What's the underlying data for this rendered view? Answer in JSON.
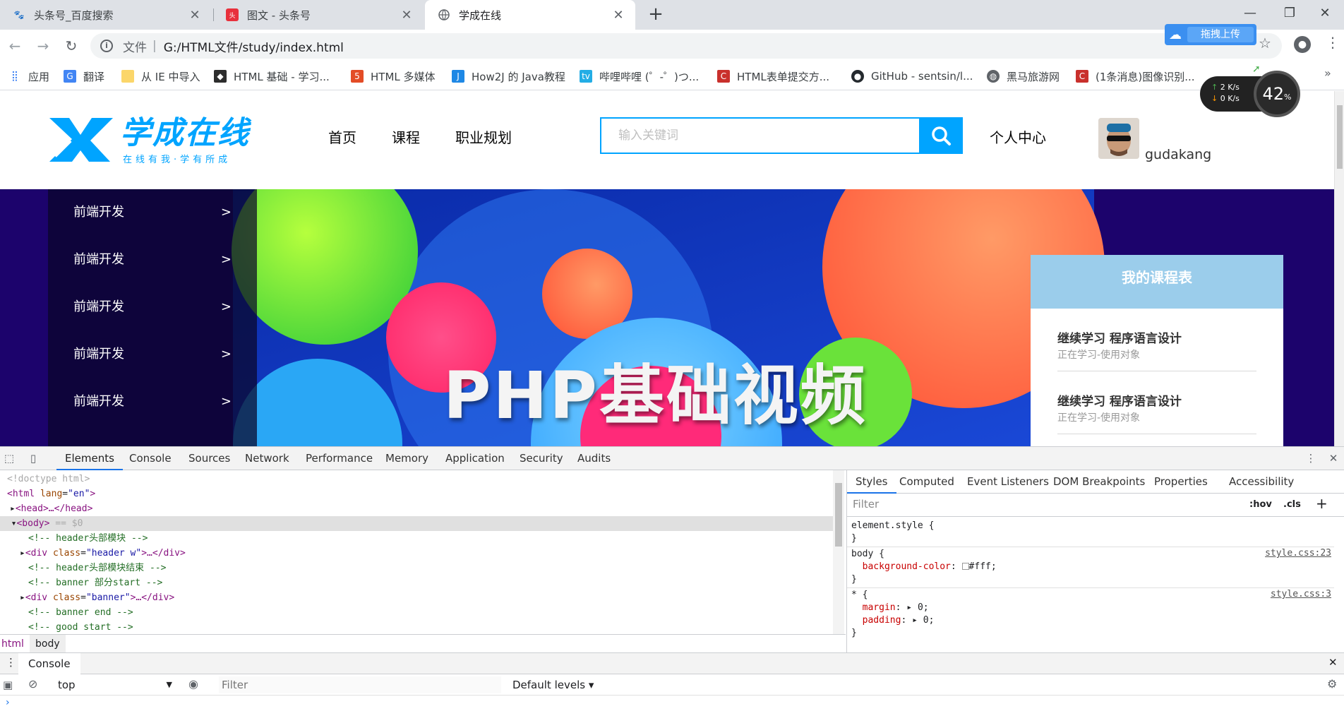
{
  "browser": {
    "tabs": [
      {
        "title": "头条号_百度搜索",
        "icon": "baidu-icon",
        "active": false
      },
      {
        "title": "图文 - 头条号",
        "icon": "toutiao-icon",
        "active": false
      },
      {
        "title": "学成在线",
        "icon": "globe-icon",
        "active": true
      }
    ],
    "address": {
      "protocol_label": "文件",
      "url": "G:/HTML文件/study/index.html"
    },
    "upload_label": "拖拽上传",
    "bookmarks": [
      {
        "label": "应用",
        "icon": "apps-icon"
      },
      {
        "label": "翻译",
        "icon": "translate-icon"
      },
      {
        "label": "从 IE 中导入",
        "icon": "folder-icon"
      },
      {
        "label": "HTML 基础 - 学习...",
        "icon": "runoob-icon"
      },
      {
        "label": "HTML 多媒体",
        "icon": "w3-icon"
      },
      {
        "label": "How2J 的 Java教程",
        "icon": "how2j-icon"
      },
      {
        "label": "哔哩哔哩 (゜-゜)つ...",
        "icon": "bilibili-icon"
      },
      {
        "label": "HTML表单提交方...",
        "icon": "csdn-icon"
      },
      {
        "label": "GitHub - sentsin/l...",
        "icon": "github-icon"
      },
      {
        "label": "黑马旅游网",
        "icon": "globe-icon"
      },
      {
        "label": "(1条消息)图像识别...",
        "icon": "csdn-icon"
      }
    ],
    "speed_widget": {
      "up": "2",
      "down": "0",
      "unit": "K/s",
      "percent": "42",
      "percent_sign": "%"
    }
  },
  "page": {
    "logo": {
      "main": "学成在线",
      "tagline": "在线有我·学有所成"
    },
    "nav": [
      "首页",
      "课程",
      "职业规划"
    ],
    "search": {
      "placeholder": "输入关键词"
    },
    "personal_center": "个人中心",
    "username": "gudakang",
    "side_menu": [
      {
        "label": "前端开发",
        "arrow": ">"
      },
      {
        "label": "前端开发",
        "arrow": ">"
      },
      {
        "label": "前端开发",
        "arrow": ">"
      },
      {
        "label": "前端开发",
        "arrow": ">"
      },
      {
        "label": "前端开发",
        "arrow": ">"
      }
    ],
    "banner_text": "PHP基础视频",
    "course_card": {
      "title": "我的课程表",
      "items": [
        {
          "title": "继续学习 程序语言设计",
          "sub": "正在学习-使用对象"
        },
        {
          "title": "继续学习 程序语言设计",
          "sub": "正在学习-使用对象"
        }
      ]
    }
  },
  "devtools": {
    "tabs": [
      "Elements",
      "Console",
      "Sources",
      "Network",
      "Performance",
      "Memory",
      "Application",
      "Security",
      "Audits"
    ],
    "dom": {
      "doctype": "<!doctype html>",
      "html_open": "<html",
      "html_attr": "lang",
      "html_val": "\"en\"",
      "html_end": ">",
      "head": "<head>…</head>",
      "body_open": "<body>",
      "body_marker": " == $0",
      "comments": [
        " header头部模块 ",
        " header头部模块结束 ",
        " banner 部分start ",
        " banner end ",
        " good start "
      ],
      "div_header_class": "\"header w\"",
      "div_banner_class": "\"banner\""
    },
    "breadcrumbs": [
      "html",
      "body"
    ],
    "styles_tabs": [
      "Styles",
      "Computed",
      "Event Listeners",
      "DOM Breakpoints",
      "Properties",
      "Accessibility"
    ],
    "styles_filter_placeholder": "Filter",
    "hov": ":hov",
    "cls": ".cls",
    "rules": {
      "element_style": "element.style {",
      "body_selector": "body {",
      "body_prop": "background-color",
      "body_value": "#fff;",
      "body_source": "style.css:23",
      "star_selector": "* {",
      "margin_prop": "margin",
      "padding_prop": "padding",
      "zero_value": "0;",
      "star_source": "style.css:3",
      "close_brace": "}"
    },
    "drawer": {
      "tab": "Console",
      "context": "top",
      "filter_placeholder": "Filter",
      "levels": "Default levels ▾"
    }
  }
}
